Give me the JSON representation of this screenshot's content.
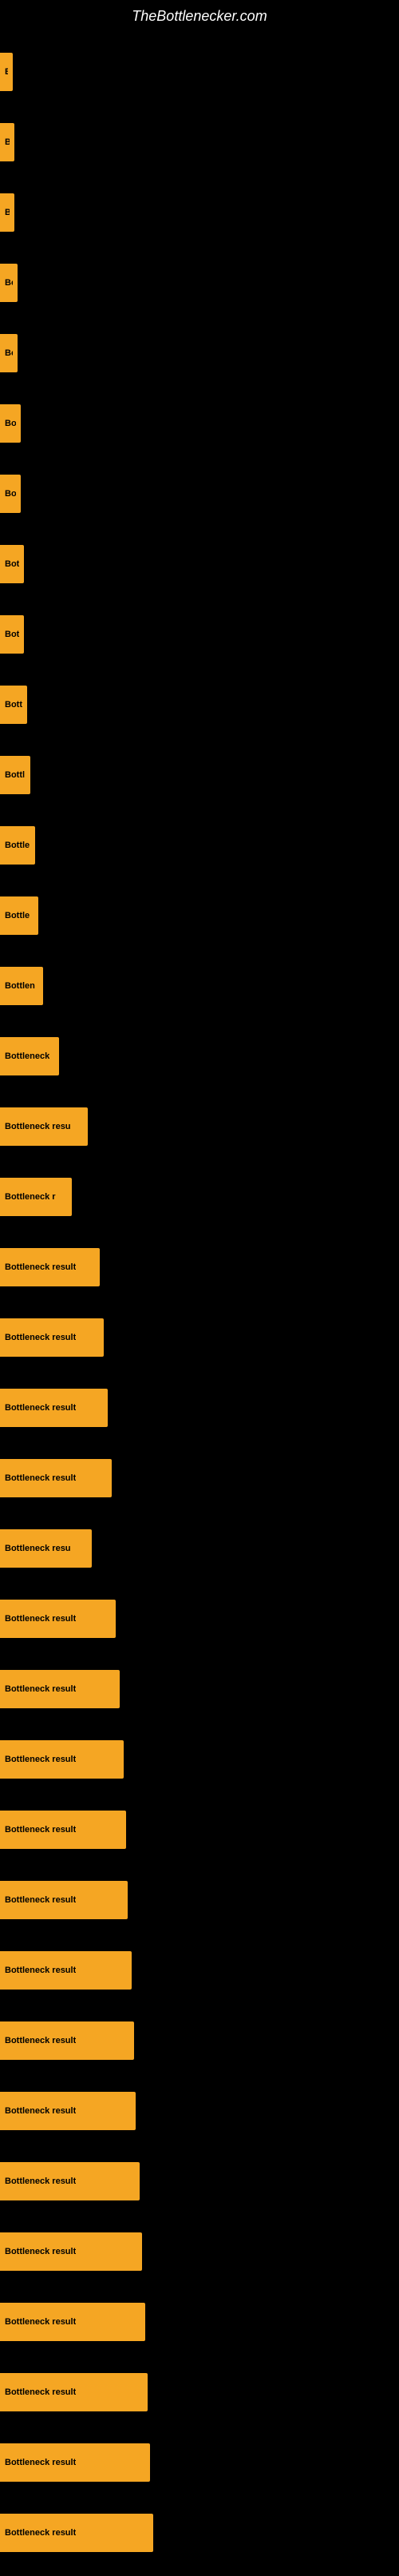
{
  "site": {
    "title": "TheBottlenecker.com"
  },
  "bars": [
    {
      "id": 1,
      "label": "B",
      "width": 16
    },
    {
      "id": 2,
      "label": "Bo",
      "width": 18
    },
    {
      "id": 3,
      "label": "Bo",
      "width": 18
    },
    {
      "id": 4,
      "label": "Bot",
      "width": 22
    },
    {
      "id": 5,
      "label": "Bot",
      "width": 22
    },
    {
      "id": 6,
      "label": "Bott",
      "width": 26
    },
    {
      "id": 7,
      "label": "Bott",
      "width": 26
    },
    {
      "id": 8,
      "label": "Bott",
      "width": 30
    },
    {
      "id": 9,
      "label": "Bott",
      "width": 30
    },
    {
      "id": 10,
      "label": "Bott",
      "width": 34
    },
    {
      "id": 11,
      "label": "Bottl",
      "width": 38
    },
    {
      "id": 12,
      "label": "Bottle",
      "width": 44
    },
    {
      "id": 13,
      "label": "Bottle",
      "width": 48
    },
    {
      "id": 14,
      "label": "Bottlen",
      "width": 54
    },
    {
      "id": 15,
      "label": "Bottleneck",
      "width": 74
    },
    {
      "id": 16,
      "label": "Bottleneck resu",
      "width": 110
    },
    {
      "id": 17,
      "label": "Bottleneck r",
      "width": 90
    },
    {
      "id": 18,
      "label": "Bottleneck result",
      "width": 125
    },
    {
      "id": 19,
      "label": "Bottleneck result",
      "width": 130
    },
    {
      "id": 20,
      "label": "Bottleneck result",
      "width": 135
    },
    {
      "id": 21,
      "label": "Bottleneck result",
      "width": 140
    },
    {
      "id": 22,
      "label": "Bottleneck resu",
      "width": 115
    },
    {
      "id": 23,
      "label": "Bottleneck result",
      "width": 145
    },
    {
      "id": 24,
      "label": "Bottleneck result",
      "width": 150
    },
    {
      "id": 25,
      "label": "Bottleneck result",
      "width": 155
    },
    {
      "id": 26,
      "label": "Bottleneck result",
      "width": 158
    },
    {
      "id": 27,
      "label": "Bottleneck result",
      "width": 160
    },
    {
      "id": 28,
      "label": "Bottleneck result",
      "width": 165
    },
    {
      "id": 29,
      "label": "Bottleneck result",
      "width": 168
    },
    {
      "id": 30,
      "label": "Bottleneck result",
      "width": 170
    },
    {
      "id": 31,
      "label": "Bottleneck result",
      "width": 175
    },
    {
      "id": 32,
      "label": "Bottleneck result",
      "width": 178
    },
    {
      "id": 33,
      "label": "Bottleneck result",
      "width": 182
    },
    {
      "id": 34,
      "label": "Bottleneck result",
      "width": 185
    },
    {
      "id": 35,
      "label": "Bottleneck result",
      "width": 188
    },
    {
      "id": 36,
      "label": "Bottleneck result",
      "width": 192
    }
  ]
}
